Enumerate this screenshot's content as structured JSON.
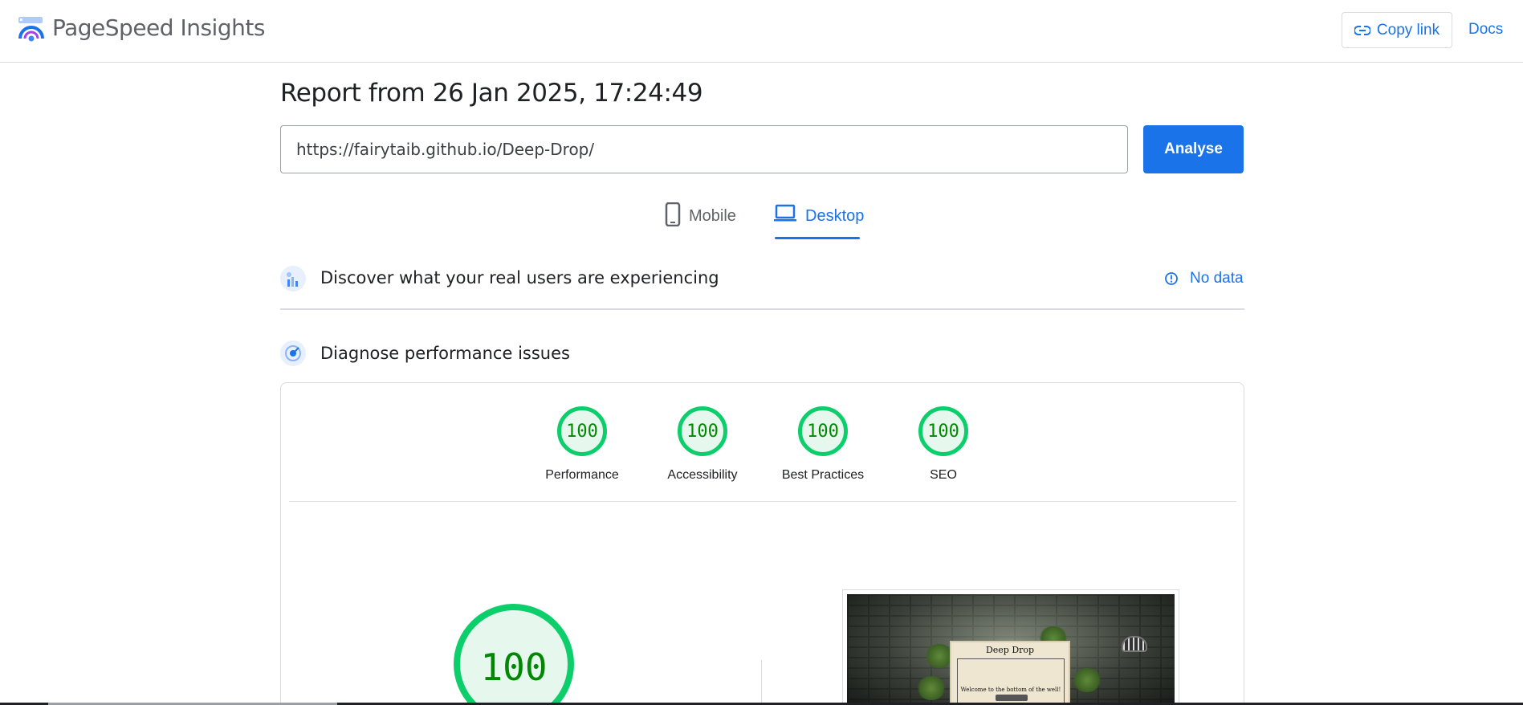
{
  "header": {
    "brand": "PageSpeed Insights",
    "copy_link": "Copy link",
    "docs": "Docs"
  },
  "report": {
    "title": "Report from 26 Jan 2025, 17:24:49",
    "url": "https://fairytaib.github.io/Deep-Drop/",
    "analyse": "Analyse"
  },
  "tabs": [
    {
      "label": "Mobile",
      "icon": "smartphone-icon",
      "active": false
    },
    {
      "label": "Desktop",
      "icon": "laptop-icon",
      "active": true
    }
  ],
  "field_data": {
    "title": "Discover what your real users are experiencing",
    "status": "No data"
  },
  "lab": {
    "title": "Diagnose performance issues",
    "scores": [
      {
        "label": "Performance",
        "value": "100"
      },
      {
        "label": "Accessibility",
        "value": "100"
      },
      {
        "label": "Best Practices",
        "value": "100"
      },
      {
        "label": "SEO",
        "value": "100"
      }
    ],
    "main_score": "100"
  },
  "screenshot": {
    "title": "Deep Drop",
    "text": "Welcome to the bottom of the well!"
  },
  "colors": {
    "accent": "#1a73e8",
    "pass": "#0cce6b",
    "pass_text": "#008800",
    "pass_fill": "#e6f8ee"
  }
}
